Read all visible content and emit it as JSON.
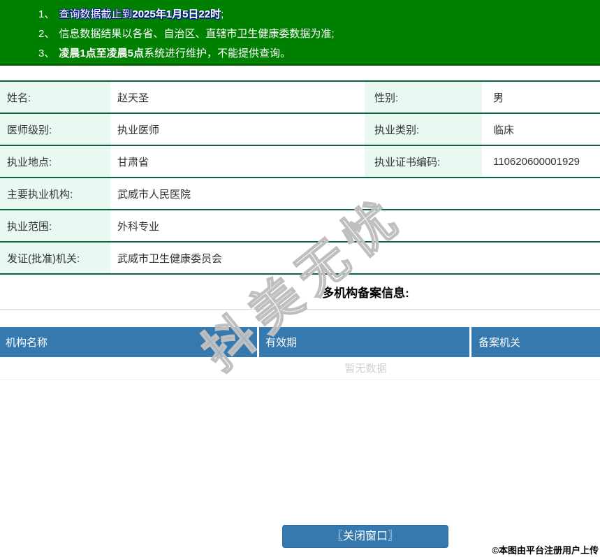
{
  "banner": {
    "bg_color": "#008000",
    "notices": [
      {
        "num": "1、",
        "pre": "查询数据截止到",
        "bold": "2025年1月5日22时",
        "post": ";"
      },
      {
        "num": "2、",
        "pre": "信息数据结果以各省、自治区、直辖市卫生健康委数据为准;",
        "bold": "",
        "post": ""
      },
      {
        "num": "3、",
        "pre": "",
        "bold": "凌晨1点至凌晨5点",
        "post": "系统进行维护，不能提供查询。"
      }
    ]
  },
  "info": {
    "label_bg_color": "#e9f8f0",
    "border_color": "#09653b",
    "rows": [
      {
        "cells": [
          {
            "label": "姓名:",
            "value": "赵天圣"
          },
          {
            "label": "性别:",
            "value": "男"
          }
        ]
      },
      {
        "cells": [
          {
            "label": "医师级别:",
            "value": "执业医师"
          },
          {
            "label": "执业类别:",
            "value": "临床"
          }
        ]
      },
      {
        "cells": [
          {
            "label": "执业地点:",
            "value": "甘肃省"
          },
          {
            "label": "执业证书编码:",
            "value": "110620600001929"
          }
        ]
      },
      {
        "cells": [
          {
            "label": "主要执业机构:",
            "value": "武威市人民医院"
          }
        ]
      },
      {
        "cells": [
          {
            "label": "执业范围:",
            "value": "外科专业"
          }
        ]
      },
      {
        "cells": [
          {
            "label": "发证(批准)机关:",
            "value": "武威市卫生健康委员会"
          }
        ]
      }
    ]
  },
  "records": {
    "section_title": "多机构备案信息:",
    "header_bg_color": "#3579ae",
    "headers": [
      "机构名称",
      "有效期",
      "备案机关"
    ],
    "empty_text": "暂无数据"
  },
  "close_button": {
    "label": "〖关闭窗口〗",
    "bg_color": "#3579ae"
  },
  "watermark_text": "抖美无忧",
  "copyright_text": "©本图由平台注册用户上传"
}
